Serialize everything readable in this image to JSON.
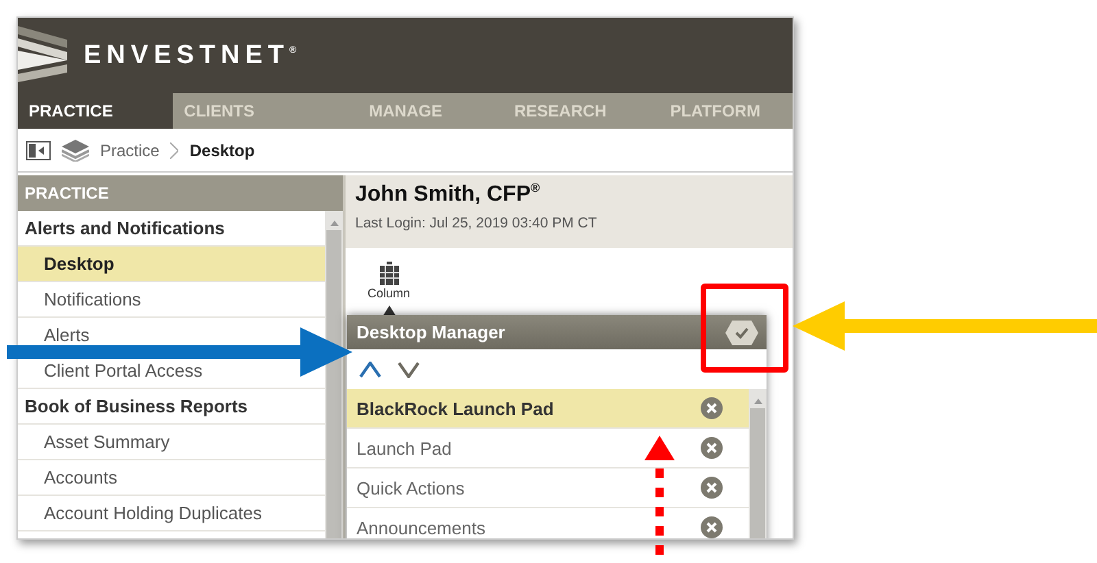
{
  "brand": {
    "name": "ENVESTNET$^{®}$"
  },
  "nav_tabs": [
    {
      "label": "PRACTICE",
      "selected": true
    },
    {
      "label": "CLIENTS",
      "selected": false
    },
    {
      "label": "MANAGE",
      "selected": false
    },
    {
      "label": "RESEARCH",
      "selected": false
    },
    {
      "label": "PLATFORM",
      "selected": false
    }
  ],
  "breadcrumb": {
    "items": [
      "Practice",
      "Desktop"
    ]
  },
  "sidebar": {
    "title": "PRACTICE",
    "items": [
      {
        "kind": "group",
        "label": "Alerts and Notifications",
        "selected": false
      },
      {
        "kind": "link",
        "label": "Desktop",
        "selected": true
      },
      {
        "kind": "link",
        "label": "Notifications",
        "selected": false
      },
      {
        "kind": "link",
        "label": "Alerts",
        "selected": false
      },
      {
        "kind": "link",
        "label": "Client Portal Access",
        "selected": false
      },
      {
        "kind": "group",
        "label": "Book of Business Reports",
        "selected": false
      },
      {
        "kind": "link",
        "label": "Asset Summary",
        "selected": false
      },
      {
        "kind": "link",
        "label": "Accounts",
        "selected": false
      },
      {
        "kind": "link",
        "label": "Account Holding Duplicates",
        "selected": false
      }
    ]
  },
  "profile": {
    "name": "John Smith, CFP$^{®}$",
    "last_login": "Last Login: Jul 25, 2019 03:40 PM CT"
  },
  "toolbar": {
    "column_label": "Column"
  },
  "desktop_manager": {
    "title": "Desktop Manager",
    "items": [
      {
        "label": "BlackRock Launch Pad",
        "selected": true
      },
      {
        "label": "Launch Pad",
        "selected": false
      },
      {
        "label": "Quick Actions",
        "selected": false
      },
      {
        "label": "Announcements",
        "selected": false
      }
    ]
  }
}
